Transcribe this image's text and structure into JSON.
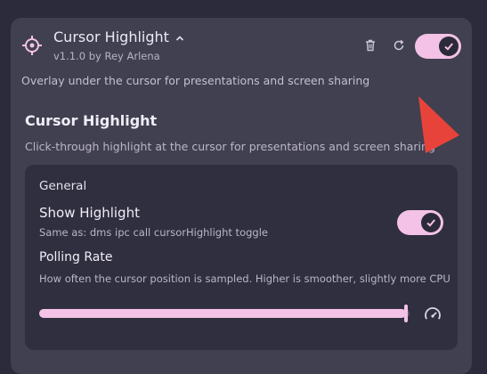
{
  "plugin": {
    "title": "Cursor Highlight",
    "subtitle": "v1.1.0 by Rey Arlena",
    "description": "Overlay under the cursor for presentations and screen sharing",
    "enabled": true,
    "icon": "crosshair-icon"
  },
  "settings": {
    "section_title": "Cursor Highlight",
    "section_description": "Click-through highlight at the cursor for presentations and screen sharing",
    "group_title": "General",
    "show_highlight": {
      "label": "Show Highlight",
      "description": "Same as: dms ipc call cursorHighlight toggle",
      "enabled": true
    },
    "polling_rate": {
      "label": "Polling Rate",
      "description": "How often the cursor position is sampled. Higher is smoother, slightly more CPU",
      "slider_fraction": 0.99
    }
  },
  "colors": {
    "accent": "#f3c2e6",
    "annotation_arrow": "#e8433a",
    "card_bg": "#414050",
    "inner_bg": "#302f3f"
  }
}
